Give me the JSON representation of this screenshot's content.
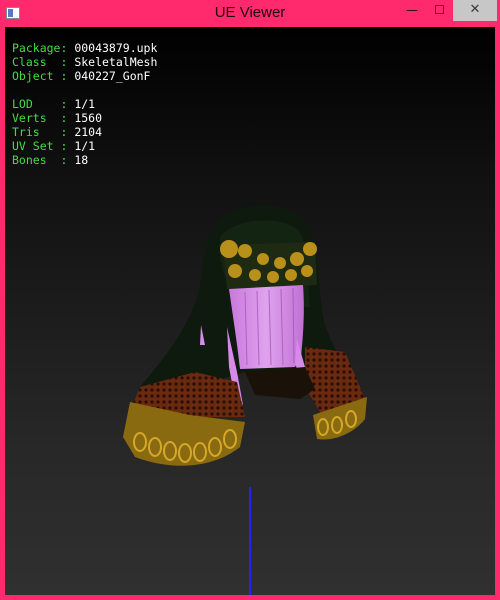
{
  "window": {
    "title": "UE Viewer",
    "minimize_glyph": "—",
    "maximize_glyph": "☐",
    "close_glyph": "✕",
    "icon": "app-window-icon"
  },
  "info": {
    "block1": [
      {
        "label": "Package: ",
        "value": "00043879.upk"
      },
      {
        "label": "Class  : ",
        "value": "SkeletalMesh"
      },
      {
        "label": "Object : ",
        "value": "040227_GonF"
      }
    ],
    "block2": [
      {
        "label": "LOD    : ",
        "value": "1/1"
      },
      {
        "label": "Verts  : ",
        "value": "1560"
      },
      {
        "label": "Tris   : ",
        "value": "2104"
      },
      {
        "label": "UV Set : ",
        "value": "1/1"
      },
      {
        "label": "Bones  : ",
        "value": "18"
      }
    ]
  },
  "colors": {
    "frame": "#ff2a6d",
    "label": "#3ee03e",
    "value": "#ffffff",
    "axis": "#2222ff",
    "hair": "#d78be8",
    "gold": "#b8901a"
  }
}
